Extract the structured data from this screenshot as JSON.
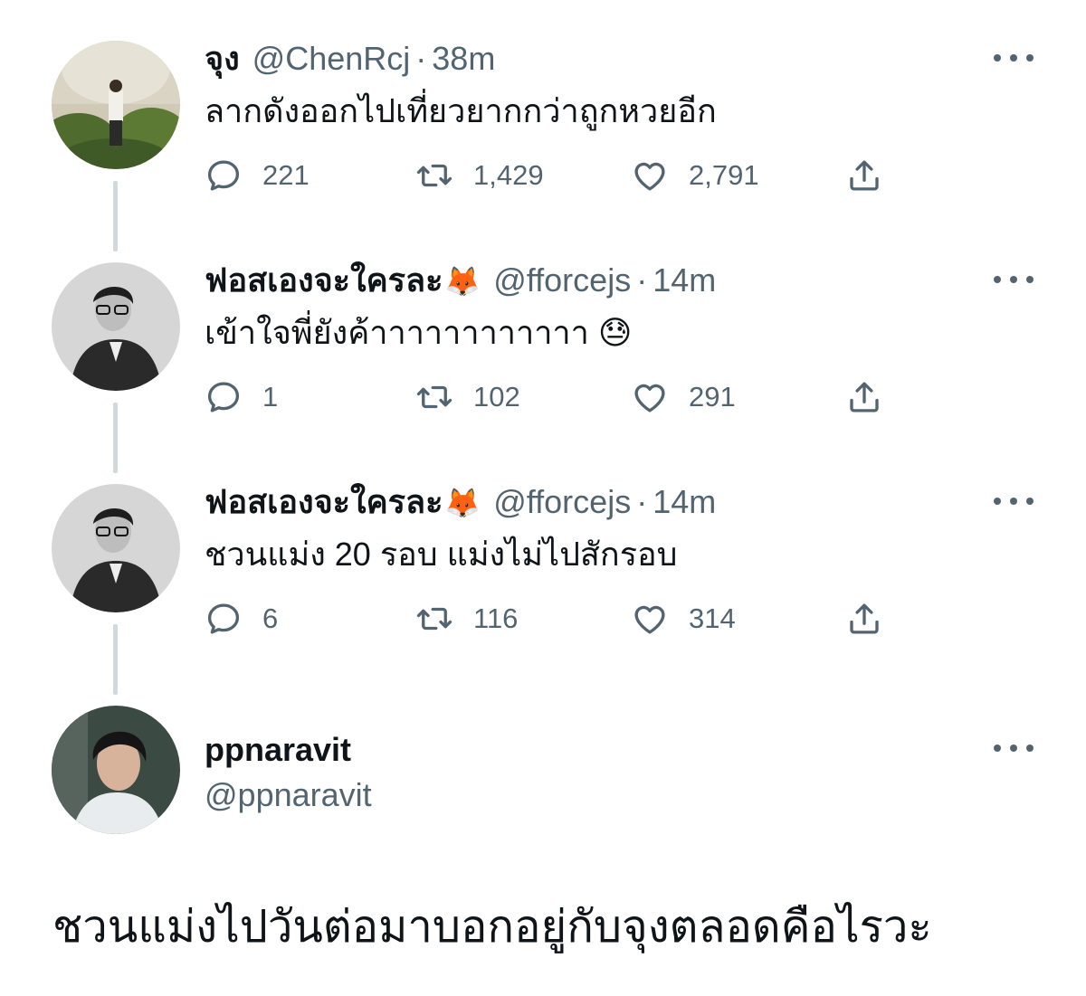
{
  "tweets": [
    {
      "name": "จุง",
      "emoji": "",
      "handle": "@ChenRcj",
      "time": "38m",
      "text": "ลากดังออกไปเที่ยวยากกว่าถูกหวยอีก",
      "replies": "221",
      "retweets": "1,429",
      "likes": "2,791"
    },
    {
      "name": "ฟอสเองจะใครละ",
      "emoji": "🦊",
      "handle": "@fforcejs",
      "time": "14m",
      "text": "เข้าใจพี่ยังค้าาาาาาาาาาาา 😓",
      "replies": "1",
      "retweets": "102",
      "likes": "291"
    },
    {
      "name": "ฟอสเองจะใครละ",
      "emoji": "🦊",
      "handle": "@fforcejs",
      "time": "14m",
      "text": "ชวนแม่ง 20 รอบ แม่งไม่ไปสักรอบ",
      "replies": "6",
      "retweets": "116",
      "likes": "314"
    }
  ],
  "profile": {
    "name": "ppnaravit",
    "handle": "@ppnaravit"
  },
  "separator": "·",
  "caption": "ชวนแม่งไปวันต่อมาบอกอยู่กับจุงตลอดคือไรวะ",
  "icons": {
    "reply": "reply-icon",
    "retweet": "retweet-icon",
    "like": "heart-icon",
    "share": "share-icon",
    "more": "more-icon"
  },
  "colors": {
    "text": "#0f1419",
    "secondary": "#536471",
    "thread_line": "#cfd9de"
  }
}
